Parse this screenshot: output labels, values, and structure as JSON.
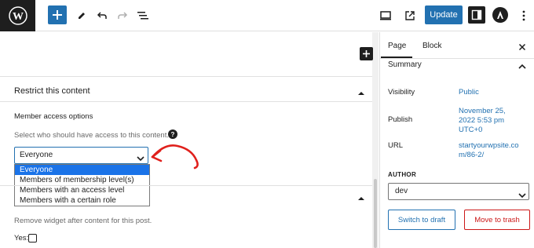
{
  "toolbar": {
    "update_label": "Update"
  },
  "editor": {
    "meta_box_title": "Restrict this content",
    "member_access_label": "Member access options",
    "member_access_help": "Select who should have access to this content.",
    "help_icon_glyph": "?",
    "select_value": "Everyone",
    "dropdown_options": [
      "Everyone",
      "Members of membership level(s)",
      "Members with an access level",
      "Members with a certain role"
    ],
    "remove_widget_text": "Remove widget after content for this post.",
    "yes_label": "Yes:"
  },
  "sidebar": {
    "tabs": [
      "Page",
      "Block"
    ],
    "summary_title": "Summary",
    "visibility_label": "Visibility",
    "visibility_value": "Public",
    "publish_label": "Publish",
    "publish_value_line1": "November 25,",
    "publish_value_line2": "2022 5:53 pm",
    "publish_value_line3": "UTC+0",
    "url_label": "URL",
    "url_value_line1": "startyourwpsite.co",
    "url_value_line2": "m/86-2/",
    "author_label": "AUTHOR",
    "author_value": "dev",
    "switch_draft_label": "Switch to draft",
    "trash_label": "Move to trash"
  },
  "colors": {
    "accent": "#2271b1",
    "selected_option": "#1a73e8",
    "danger": "#cc1818",
    "annotation_arrow": "#e0201c",
    "dark": "#1e1e1e"
  }
}
